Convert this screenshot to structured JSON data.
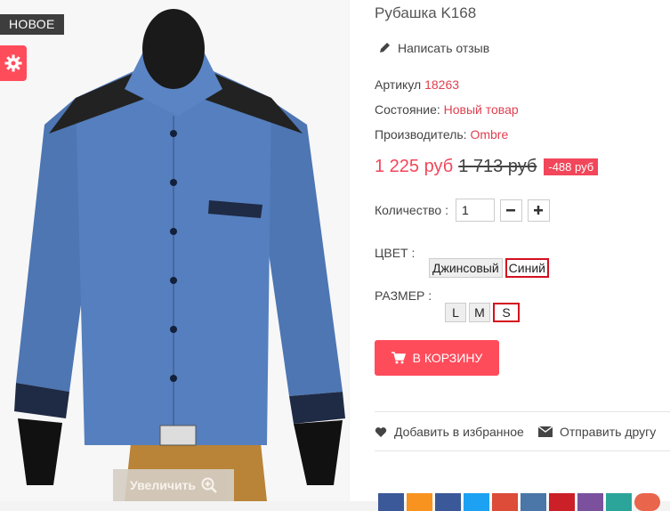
{
  "product": {
    "badge": "НОВОЕ",
    "zoom_label": "Увеличить",
    "title": "Рубашка K168",
    "review_link": "Написать отзыв",
    "sku": {
      "label": "Артикул",
      "value": "18263"
    },
    "condition": {
      "label": "Состояние:",
      "value": "Новый товар"
    },
    "manufacturer": {
      "label": "Производитель:",
      "value": "Ombre"
    },
    "price": "1 225 руб",
    "old_price": "1 713 руб",
    "discount": "-488 руб",
    "quantity": {
      "label": "Количество :",
      "value": "1",
      "minus": "−",
      "plus": "+"
    },
    "color": {
      "label": "ЦВЕТ :",
      "options": [
        "Джинсовый",
        "Синий"
      ],
      "selected": "Синий"
    },
    "size": {
      "label": "РАЗМЕР :",
      "options": [
        "L",
        "M",
        "S"
      ],
      "selected": "S"
    },
    "cart_button": "В КОРЗИНУ",
    "wishlist": "Добавить в избранное",
    "send_friend": "Отправить другу"
  },
  "colors": {
    "accent": "#ff4c5b",
    "price": "#f2465a",
    "link": "#e04050",
    "selected_border": "#d40f1e",
    "shirt": "#4f78b5"
  },
  "icons": {
    "gear": "gear-icon",
    "pencil": "pencil-icon",
    "cart": "cart-icon",
    "heart": "heart-icon",
    "envelope": "envelope-icon",
    "zoom": "zoom-in-icon"
  },
  "social_colors": [
    "#3b5998",
    "#f7931e",
    "#3b5998",
    "#1da1f2",
    "#dd4b39",
    "#4a76a8",
    "#cb2027",
    "#7b519d",
    "#2ba59a",
    "#e9654b"
  ]
}
